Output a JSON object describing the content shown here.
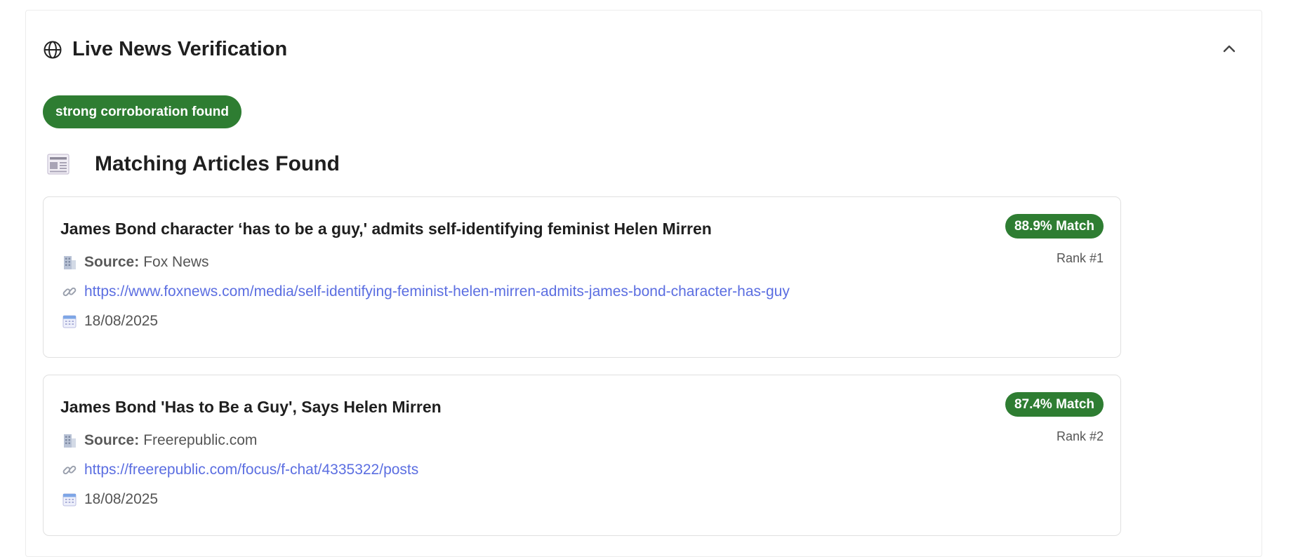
{
  "panel": {
    "title": "Live News Verification",
    "status": "strong corroboration found",
    "section_title": "Matching Articles Found",
    "source_label": "Source:",
    "icons": {
      "header": "globe-icon",
      "collapse": "chevron-up-icon",
      "section": "newspaper-icon",
      "source": "building-icon",
      "link": "link-icon",
      "date": "calendar-icon"
    }
  },
  "colors": {
    "accent_green": "#2e7d32",
    "link_blue": "#5b6ee1"
  },
  "articles": [
    {
      "title": "James Bond character ‘has to be a guy,' admits self-identifying feminist Helen Mirren",
      "match": "88.9% Match",
      "rank": "Rank #1",
      "source": "Fox News",
      "url": "https://www.foxnews.com/media/self-identifying-feminist-helen-mirren-admits-james-bond-character-has-guy",
      "date": "18/08/2025"
    },
    {
      "title": "James Bond 'Has to Be a Guy', Says Helen Mirren",
      "match": "87.4% Match",
      "rank": "Rank #2",
      "source": "Freerepublic.com",
      "url": "https://freerepublic.com/focus/f-chat/4335322/posts",
      "date": "18/08/2025"
    }
  ]
}
